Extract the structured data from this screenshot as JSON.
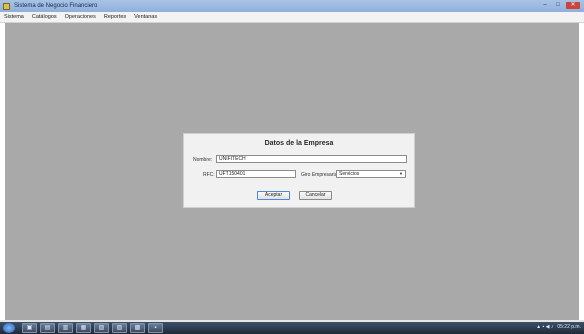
{
  "window": {
    "title": "Sistema de Negocio Financiero",
    "minimize_glyph": "–",
    "maximize_glyph": "□",
    "close_glyph": "✕"
  },
  "menu": {
    "items": [
      "Sistema",
      "Catálogos",
      "Operaciones",
      "Reportes",
      "Ventanas"
    ]
  },
  "dialog": {
    "title": "Datos de la Empresa",
    "nombre_label": "Nombre:",
    "nombre_value": "UNIFITECH",
    "rfc_label": "RFC:",
    "rfc_value": "UFT150401",
    "giro_label": "Giro Empresarial:",
    "giro_value": "Servicios",
    "aceptar_label": "Aceptar",
    "cancelar_label": "Cancelar"
  },
  "taskbar": {
    "items": [
      "▣",
      "▤",
      "▥",
      "▦",
      "▧",
      "▨",
      "▩",
      "▪"
    ],
    "tray": {
      "icons": "▲ ▪ ◀ ♪",
      "time": "05:22 p.m."
    }
  },
  "colors": {
    "client_bg": "#a9a9a9",
    "dialog_bg": "#f1f1f1",
    "titlebar": "#8fb0dc",
    "taskbar": "#1e2a3a"
  }
}
